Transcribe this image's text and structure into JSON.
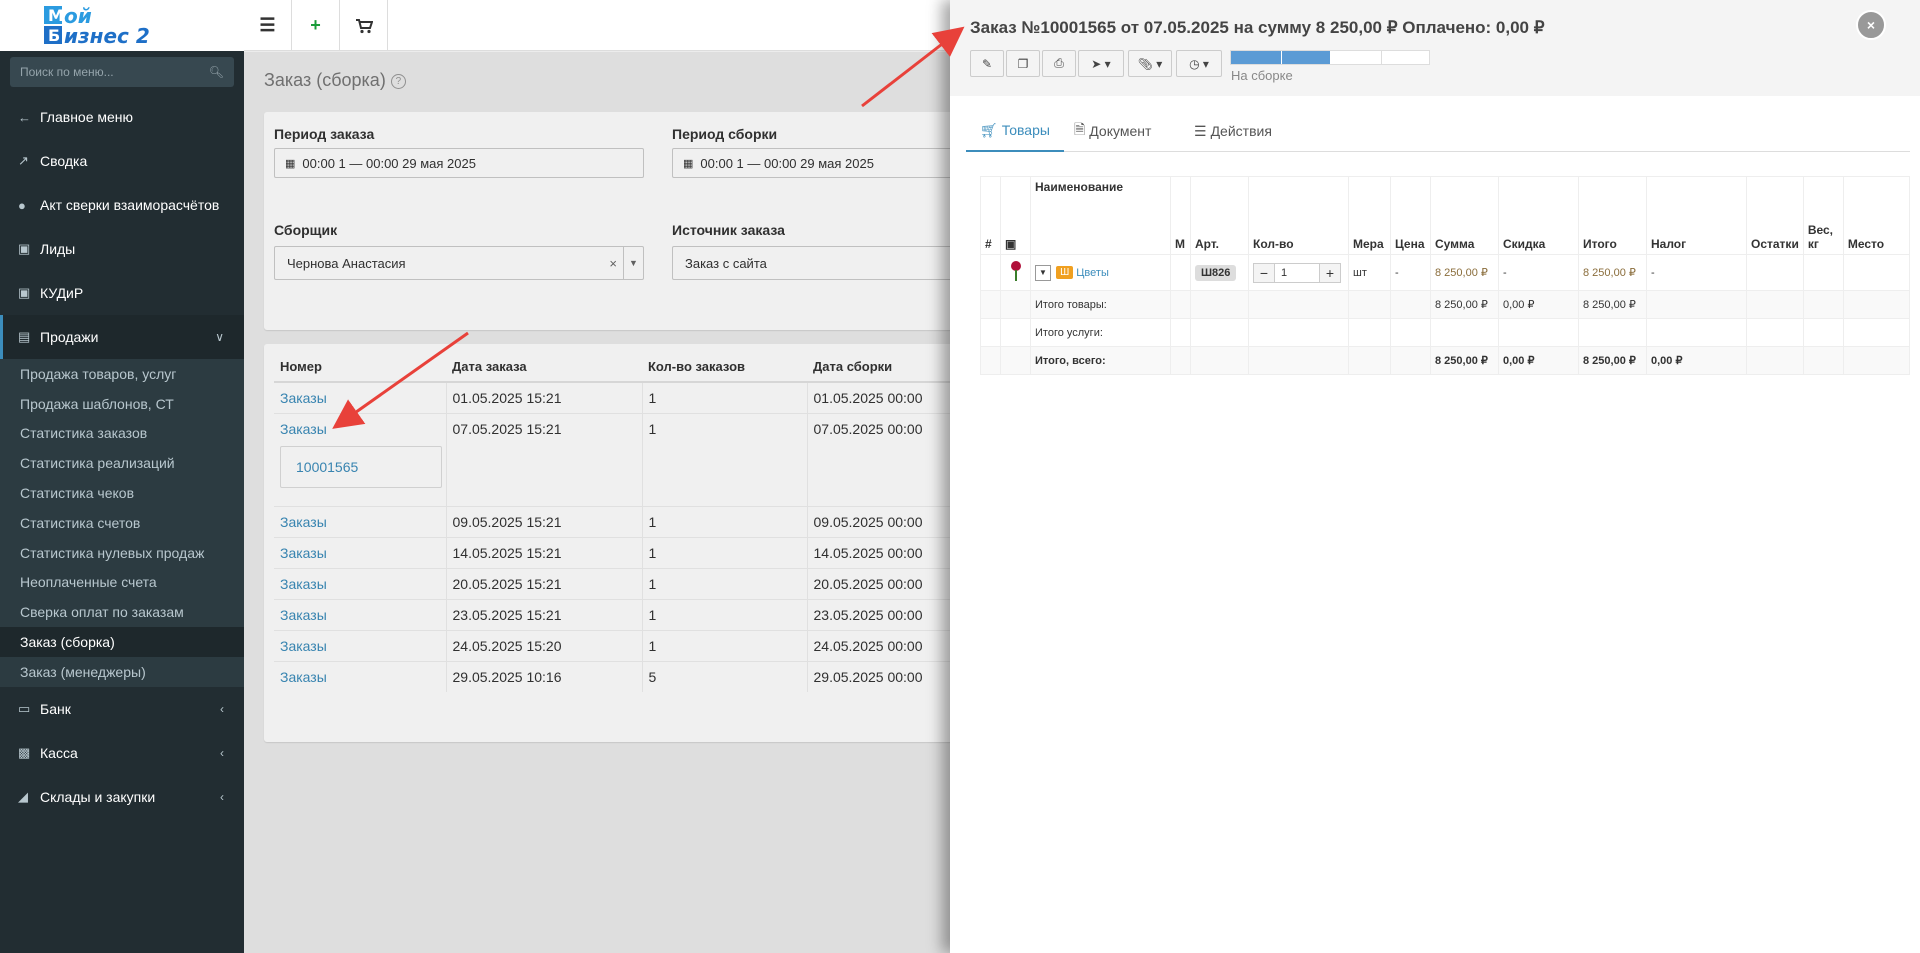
{
  "logo": {
    "text_top": "ой",
    "text_bottom": "изнес 2",
    "letter_m": "М",
    "letter_b": "Б"
  },
  "sidebar": {
    "search_placeholder": "Поиск по меню...",
    "items": [
      {
        "label": "Главное меню",
        "icon": "arrow-left-icon"
      },
      {
        "label": "Сводка",
        "icon": "chart-line-icon"
      },
      {
        "label": "Акт сверки взаиморасчётов",
        "icon": "users-icon"
      },
      {
        "label": "Лиды",
        "icon": "id-card-icon"
      },
      {
        "label": "КУДиР",
        "icon": "id-card-icon"
      },
      {
        "label": "Продажи",
        "icon": "bar-chart-icon"
      },
      {
        "label": "Банк",
        "icon": "credit-card-icon"
      },
      {
        "label": "Касса",
        "icon": "money-icon"
      },
      {
        "label": "Склады и закупки",
        "icon": "cube-icon"
      }
    ],
    "sales_sub": [
      "Продажа товаров, услуг",
      "Продажа шаблонов, СТ",
      "Статистика заказов",
      "Статистика реализаций",
      "Статистика чеков",
      "Статистика счетов",
      "Статистика нулевых продаж",
      "Неоплаченные счета",
      "Сверка оплат по заказам",
      "Заказ (сборка)",
      "Заказ (менеджеры)"
    ]
  },
  "page": {
    "title": "Заказ (сборка)",
    "filters": {
      "order_period_label": "Период заказа",
      "order_period_value": "00:00 1 — 00:00 29 мая 2025",
      "assembly_period_label": "Период сборки",
      "assembly_period_value": "00:00 1 — 00:00 29 мая 2025",
      "assembler_label": "Сборщик",
      "assembler_value": "Чернова Анастасия",
      "source_label": "Источник заказа",
      "source_value": "Заказ с сайта"
    },
    "table": {
      "headers": [
        "Номер",
        "Дата заказа",
        "Кол-во заказов",
        "Дата сборки"
      ],
      "rows": [
        {
          "number": "Заказы",
          "order_date": "01.05.2025 15:21",
          "count": "1",
          "assembly_date": "01.05.2025 00:00"
        },
        {
          "number": "Заказы",
          "order_date": "07.05.2025 15:21",
          "count": "1",
          "assembly_date": "07.05.2025 00:00",
          "popup": "10001565"
        },
        {
          "number": "Заказы",
          "order_date": "09.05.2025 15:21",
          "count": "1",
          "assembly_date": "09.05.2025 00:00"
        },
        {
          "number": "Заказы",
          "order_date": "14.05.2025 15:21",
          "count": "1",
          "assembly_date": "14.05.2025 00:00"
        },
        {
          "number": "Заказы",
          "order_date": "20.05.2025 15:21",
          "count": "1",
          "assembly_date": "20.05.2025 00:00"
        },
        {
          "number": "Заказы",
          "order_date": "23.05.2025 15:21",
          "count": "1",
          "assembly_date": "23.05.2025 00:00"
        },
        {
          "number": "Заказы",
          "order_date": "24.05.2025 15:20",
          "count": "1",
          "assembly_date": "24.05.2025 00:00"
        },
        {
          "number": "Заказы",
          "order_date": "29.05.2025 10:16",
          "count": "5",
          "assembly_date": "29.05.2025 00:00"
        }
      ]
    }
  },
  "panel": {
    "title": "Заказ №10001565 от 07.05.2025 на сумму 8 250,00 ₽ Оплачено: 0,00 ₽",
    "status": "На сборке",
    "progress": 0.5,
    "tabs": [
      "Товары",
      "Документ",
      "Действия"
    ],
    "items_table": {
      "headers": [
        "#",
        "",
        "Наименование",
        "М",
        "Арт.",
        "Кол-во",
        "Мера",
        "Цена",
        "Сумма",
        "Скидка",
        "Итого",
        "Налог",
        "Остатки",
        "Вес, кг",
        "Место"
      ],
      "item": {
        "badge": "Ш",
        "name": "Цветы",
        "art": "Ш826",
        "qty": "1",
        "unit": "шт",
        "price": "-",
        "sum": "8 250,00 ₽",
        "discount": "-",
        "total": "8 250,00 ₽",
        "tax": "-"
      },
      "totals": [
        {
          "label": "Итого товары:",
          "sum": "8 250,00 ₽",
          "discount": "0,00 ₽",
          "total": "8 250,00 ₽",
          "tax": ""
        },
        {
          "label": "Итого услуги:",
          "sum": "",
          "discount": "",
          "total": "",
          "tax": ""
        },
        {
          "label": "Итого, всего:",
          "sum": "8 250,00 ₽",
          "discount": "0,00 ₽",
          "total": "8 250,00 ₽",
          "tax": "0,00 ₽"
        }
      ]
    }
  },
  "colors": {
    "accent": "#3c8dbc",
    "sidebar": "#222d32",
    "arrow": "#e8413a",
    "badge": "#f0a020",
    "amount": "#8a6d3b"
  }
}
